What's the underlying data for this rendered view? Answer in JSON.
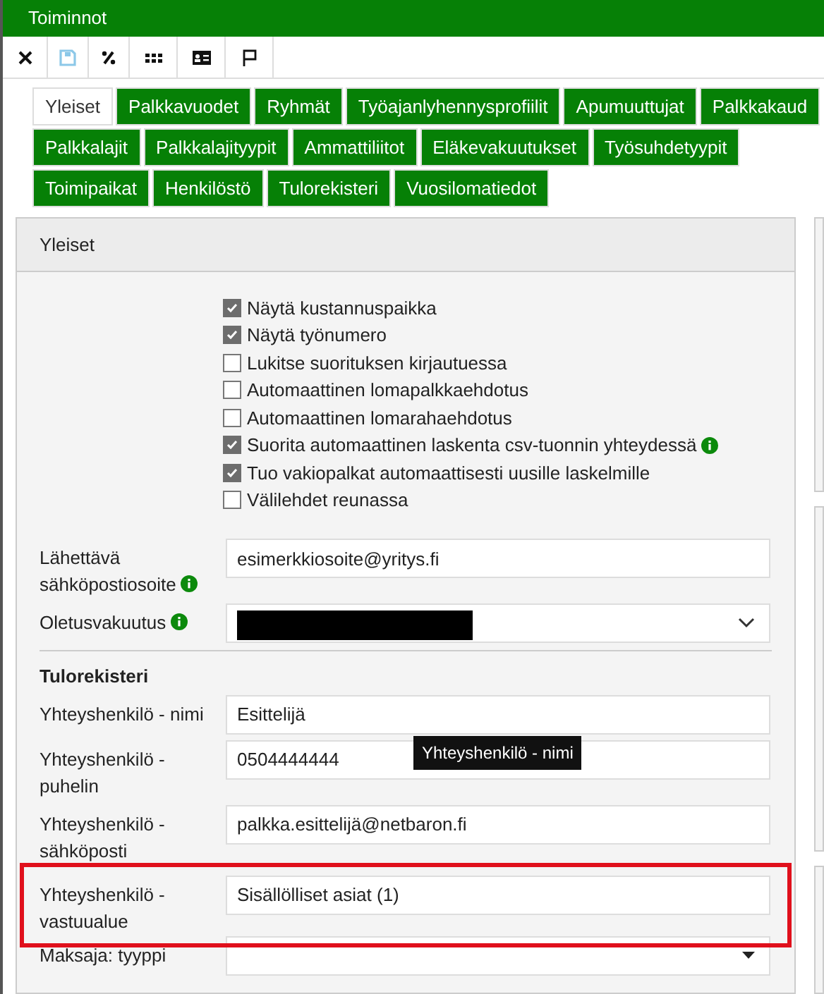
{
  "window": {
    "title": "Toiminnot"
  },
  "toolbar": [
    {
      "kind": "close",
      "disabled": false
    },
    {
      "kind": "save",
      "disabled": true
    },
    {
      "kind": "percent",
      "disabled": false
    },
    {
      "kind": "grid",
      "disabled": false
    },
    {
      "kind": "card",
      "disabled": false
    },
    {
      "kind": "flag",
      "disabled": false
    }
  ],
  "tab_rows": [
    [
      {
        "label": "Yleiset",
        "selected": true
      },
      {
        "label": "Palkkavuodet",
        "selected": false
      },
      {
        "label": "Ryhmät",
        "selected": false
      },
      {
        "label": "Työajanlyhennysprofiilit",
        "selected": false
      },
      {
        "label": "Apumuuttujat",
        "selected": false
      },
      {
        "label": "Palkkakaud",
        "selected": false
      }
    ],
    [
      {
        "label": "Palkkalajit",
        "selected": false
      },
      {
        "label": "Palkkalajityypit",
        "selected": false
      },
      {
        "label": "Ammattiliitot",
        "selected": false
      },
      {
        "label": "Eläkevakuutukset",
        "selected": false
      },
      {
        "label": "Työsuhdetyypit",
        "selected": false
      }
    ],
    [
      {
        "label": "Toimipaikat",
        "selected": false
      },
      {
        "label": "Henkilöstö",
        "selected": false
      },
      {
        "label": "Tulorekisteri",
        "selected": false
      },
      {
        "label": "Vuosilomatiedot",
        "selected": false
      }
    ]
  ],
  "panel": {
    "title": "Yleiset",
    "checkboxes": [
      {
        "label": "Näytä kustannuspaikka",
        "checked": true,
        "info": false
      },
      {
        "label": "Näytä työnumero",
        "checked": true,
        "info": false
      },
      {
        "label": "Lukitse suorituksen kirjautuessa",
        "checked": false,
        "info": false
      },
      {
        "label": "Automaattinen lomapalkkaehdotus",
        "checked": false,
        "info": false
      },
      {
        "label": "Automaattinen lomarahaehdotus",
        "checked": false,
        "info": false
      },
      {
        "label": "Suorita automaattinen laskenta csv-tuonnin yhteydessä",
        "checked": true,
        "info": true
      },
      {
        "label": "Tuo vakiopalkat automaattisesti uusille laskelmille",
        "checked": true,
        "info": false
      },
      {
        "label": "Välilehdet reunassa",
        "checked": false,
        "info": false
      }
    ],
    "fields": [
      {
        "kind": "text",
        "label": "Lähettävä sähköpostiosoite",
        "info": true,
        "value": "esimerkkiosoite@yritys.fi"
      },
      {
        "kind": "select",
        "label": "Oletusvakuutus",
        "info": true,
        "redacted": true
      }
    ],
    "section": "Tulorekisteri",
    "section_fields": [
      {
        "kind": "text",
        "label": "Yhteyshenkilö - nimi",
        "value": "Esittelijä",
        "highlighted": false
      },
      {
        "kind": "text",
        "label": "Yhteyshenkilö - puhelin",
        "value": "0504444444",
        "highlighted": false
      },
      {
        "kind": "text",
        "label": "Yhteyshenkilö - sähköposti",
        "value": "palkka.esittelijä@netbaron.fi",
        "highlighted": false
      },
      {
        "kind": "text",
        "label": "Yhteyshenkilö - vastuualue",
        "value": "Sisällölliset asiat (1)",
        "highlighted": true
      },
      {
        "kind": "dropdown",
        "label": "Maksaja: tyyppi",
        "highlighted": false
      }
    ],
    "tooltip": {
      "text": "Yhteyshenkilö - nimi"
    }
  }
}
